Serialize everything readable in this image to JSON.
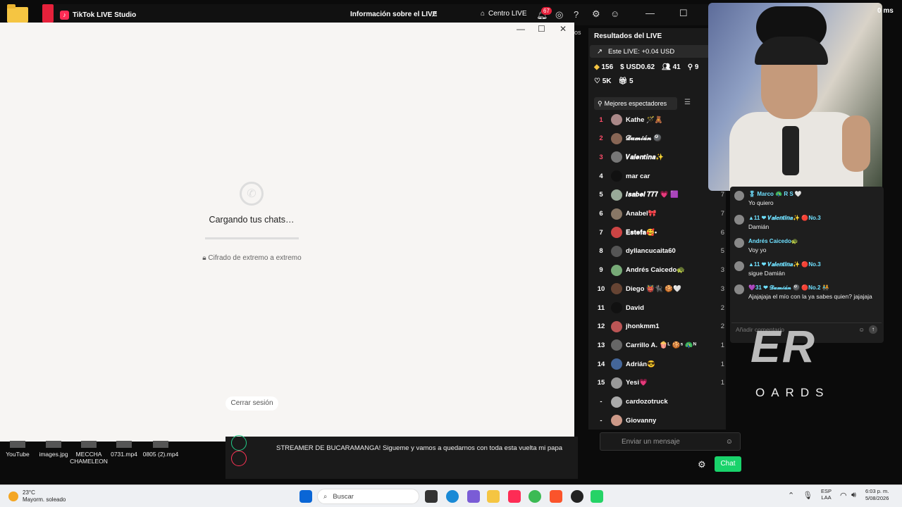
{
  "tiktok": {
    "app_title": "TikTok LIVE Studio",
    "info_live": "Información sobre el LIVE",
    "centro_live": "Centro LIVE",
    "notification_count": "67",
    "side_cut_text": "os"
  },
  "whatsapp": {
    "loading_text": "Cargando tus chats…",
    "cipher_text": "Cifrado de extremo a extremo",
    "logout_label": "Cerrar sesión"
  },
  "results": {
    "title": "Resultados del LIVE",
    "este_live": "Este LIVE: +0.04 USD",
    "diamonds": "156",
    "usd": "USD0.62",
    "viewers": "41",
    "followers_new": "9",
    "likes": "5K",
    "gifts": "5",
    "tab_label": "Mejores espectadores",
    "top_viewers": [
      {
        "rank": "1",
        "name": "Kathe 🪄🧸",
        "count": ""
      },
      {
        "rank": "2",
        "name": "𝓓𝓪𝓶𝓲𝓪́𝓷 🎱",
        "count": ""
      },
      {
        "rank": "3",
        "name": "𝑽𝒂𝒍𝒆𝒏𝒕𝒊𝒏𝒂✨",
        "count": ""
      },
      {
        "rank": "4",
        "name": "mar car",
        "count": ""
      },
      {
        "rank": "5",
        "name": "𝑰𝒔𝒂𝒃𝒆𝒍 𝟕𝟕𝟕 💗 🟪",
        "count": "7"
      },
      {
        "rank": "6",
        "name": "Anabel🎀",
        "count": "7"
      },
      {
        "rank": "7",
        "name": "𝐄𝐬𝐭𝐞𝐟𝐚🥰•",
        "count": "6"
      },
      {
        "rank": "8",
        "name": "dyllancucaita60",
        "count": "5"
      },
      {
        "rank": "9",
        "name": "Andrés Caicedo🐢",
        "count": "3"
      },
      {
        "rank": "10",
        "name": "Diego 👹🐈‍⬛ 🍪🤍",
        "count": "3"
      },
      {
        "rank": "11",
        "name": "David",
        "count": "2"
      },
      {
        "rank": "12",
        "name": "jhonkmm1",
        "count": "2"
      },
      {
        "rank": "13",
        "name": "Carrillo A. 🍿ᴸ 🍪ˢ 🦚ᴺ",
        "count": "1"
      },
      {
        "rank": "14",
        "name": "Adrián😎",
        "count": "1"
      },
      {
        "rank": "15",
        "name": "Yesi💗",
        "count": "1"
      },
      {
        "rank": "-",
        "name": "cardozotruck",
        "count": ""
      },
      {
        "rank": "-",
        "name": "Giovanny",
        "count": ""
      }
    ]
  },
  "chat": {
    "messages": [
      {
        "name": "🎖 Marco 🦚 R S 🤍",
        "text": "Yo quiero"
      },
      {
        "name": "▲11 ❤ 𝑽𝒂𝒍𝒆𝒏𝒕𝒊𝒏𝒂✨ 🔴No.3",
        "text": "Damián"
      },
      {
        "name": "Andrés Caicedo🐢",
        "text": "Voy yo"
      },
      {
        "name": "▲11 ❤ 𝑽𝒂𝒍𝒆𝒏𝒕𝒊𝒏𝒂✨ 🔴No.3",
        "text": "sigue Damián"
      },
      {
        "name": "💜31 ❤ 𝓓𝓪𝓶𝓲𝓪́𝓷 🎱 🔴No.2 🧑‍🤝‍🧑",
        "text": "Ajajajaja el mío con la ya sabes quien? jajajaja"
      }
    ],
    "input_placeholder": "Añadir comentario"
  },
  "overlay": {
    "latency": "0 ms",
    "logo_text": "ER",
    "boards_text": "OARDS"
  },
  "stream": {
    "description": "STREAMER DE BUCARAMANGA! Sigueme y vamos a quedarnos con toda esta vuelta mi papa",
    "send_placeholder": "Enviar un mensaje",
    "chat_button": "Chat"
  },
  "desktop_files": [
    {
      "name": "YouTube"
    },
    {
      "name": "images.jpg"
    },
    {
      "name": "MECCHA CHAMELEON"
    },
    {
      "name": "0731.mp4"
    },
    {
      "name": "0805 (2).mp4"
    }
  ],
  "taskbar": {
    "temperature": "23°C",
    "weather": "Mayorm. soleado",
    "search_placeholder": "Buscar",
    "lang_line1": "ESP",
    "lang_line2": "LAA",
    "time": "6:03 p. m.",
    "date": "5/08/2026"
  }
}
